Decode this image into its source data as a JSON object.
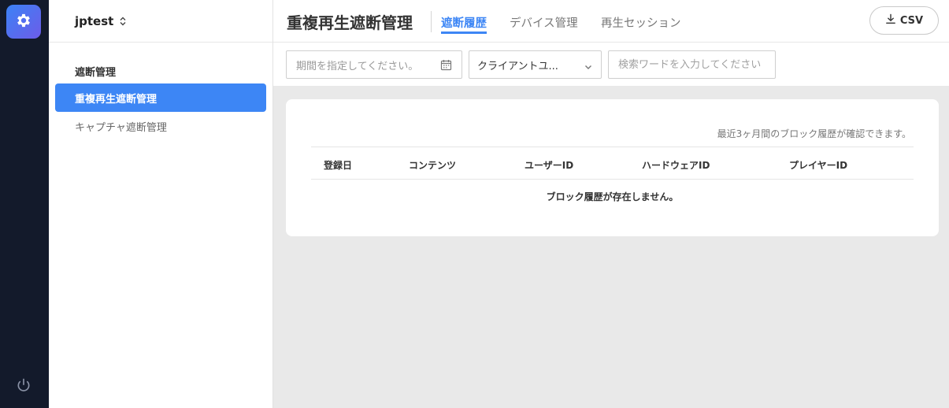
{
  "sidebar": {
    "tenant": "jptest",
    "section_title": "遮断管理",
    "items": [
      {
        "label": "重複再生遮断管理",
        "active": true
      },
      {
        "label": "キャプチャ遮断管理",
        "active": false
      }
    ]
  },
  "header": {
    "title": "重複再生遮断管理",
    "tabs": [
      {
        "label": "遮断履歴",
        "active": true
      },
      {
        "label": "デバイス管理",
        "active": false
      },
      {
        "label": "再生セッション",
        "active": false
      }
    ],
    "csv_label": "CSV"
  },
  "filters": {
    "date_placeholder": "期間を指定してください。",
    "client_select_value": "クライアントユ...",
    "search_placeholder": "検索ワードを入力してください"
  },
  "history": {
    "note": "最近3ヶ月間のブロック履歴が確認できます。",
    "columns": [
      "登録日",
      "コンテンツ",
      "ユーザーID",
      "ハードウェアID",
      "プレイヤーID"
    ],
    "empty_message": "ブロック履歴が存在しません。"
  },
  "icons": {
    "app": "gear-icon",
    "power": "power-icon",
    "tenant_switch": "updown-chevron-icon",
    "csv": "download-icon",
    "date": "calendar-icon",
    "select": "chevron-down-icon"
  },
  "colors": {
    "accent": "#3d86f5",
    "rail": "#131a2b",
    "logo_gradient_start": "#3b82f6",
    "logo_gradient_end": "#6d5ce8"
  }
}
